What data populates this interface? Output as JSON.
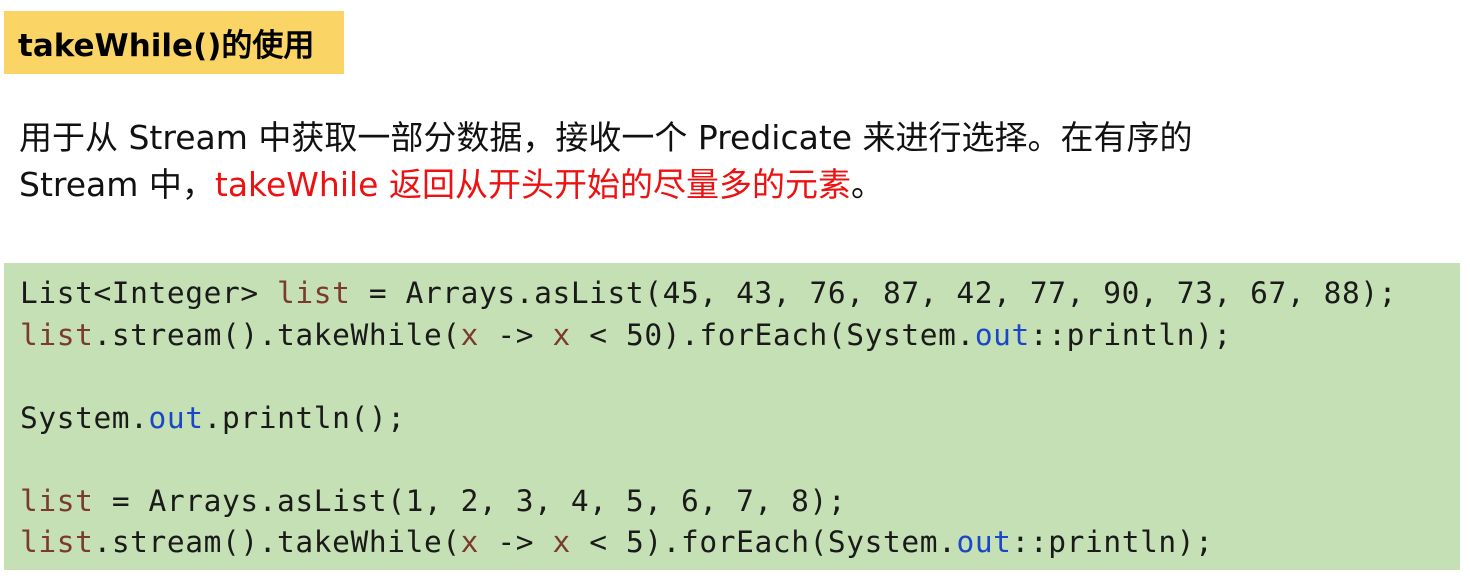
{
  "title": "takeWhile()的使用",
  "description": {
    "line1": "用于从 Stream 中获取一部分数据，接收一个 Predicate 来进行选择。在有序的",
    "line2_prefix": "Stream 中，",
    "line2_highlight": "takeWhile 返回从开头开始的尽量多的元素",
    "line2_suffix": "。"
  },
  "code": {
    "line1": {
      "a": "List<Integer> ",
      "v1": "list",
      "b": " = Arrays.asList(45, 43, 76, 87, 42, 77, 90, 73, 67, 88);"
    },
    "line2": {
      "v1": "list",
      "a": ".stream().takeWhile(",
      "v2": "x",
      "b": " -> ",
      "v3": "x",
      "c": " < 50).forEach(System.",
      "f": "out",
      "d": "::println);"
    },
    "line3": {
      "a": "System.",
      "f": "out",
      "b": ".println();"
    },
    "line4": {
      "v1": "list",
      "a": " = Arrays.asList(1, 2, 3, 4, 5, 6, 7, 8);"
    },
    "line5": {
      "v1": "list",
      "a": ".stream().takeWhile(",
      "v2": "x",
      "b": " -> ",
      "v3": "x",
      "c": " < 5).forEach(System.",
      "f": "out",
      "d": "::println);"
    }
  },
  "colors": {
    "title_bg": "#fad565",
    "highlight_text": "#ee1111",
    "code_bg": "#c5e0b4",
    "variable": "#7b3a2f",
    "field": "#1a47c8"
  }
}
